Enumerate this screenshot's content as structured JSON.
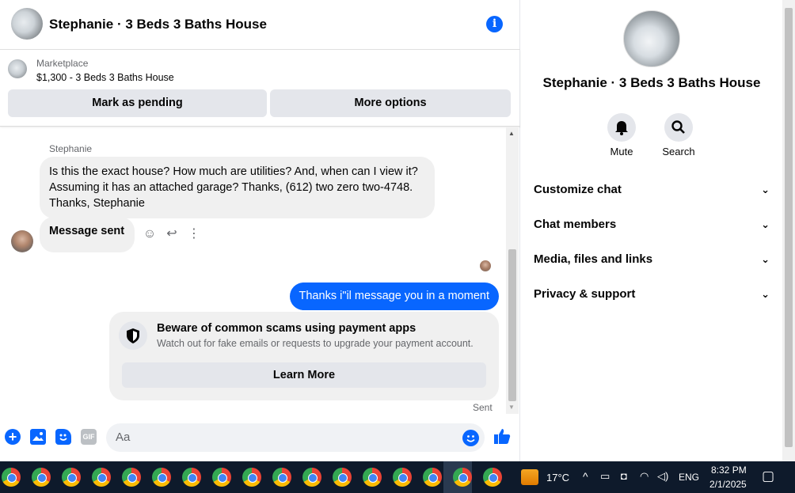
{
  "header": {
    "title": "Stephanie · 3 Beds 3 Baths House",
    "info_icon": "info-icon"
  },
  "marketplace": {
    "label": "Marketplace",
    "price_title": "$1,300 - 3 Beds 3 Baths House",
    "mark_pending": "Mark as pending",
    "more_options": "More options"
  },
  "messages": {
    "sender_name": "Stephanie",
    "incoming_text": "Is this the exact house? How much are utilities? And, when can I view it? Assuming it has an attached garage? Thanks, (612) two zero two-4748. Thanks, Stephanie",
    "sent_notice": "Message sent",
    "outgoing_text": "Thanks i\"il message you in a moment",
    "status": "Sent"
  },
  "scam_warning": {
    "title": "Beware of common scams using payment apps",
    "subtitle": "Watch out for fake emails or requests to upgrade your payment account.",
    "button": "Learn More"
  },
  "composer": {
    "placeholder": "Aa",
    "gif_label": "GIF"
  },
  "side_panel": {
    "title": "Stephanie · 3 Beds 3 Baths House",
    "mute_label": "Mute",
    "search_label": "Search",
    "sections": [
      "Customize chat",
      "Chat members",
      "Media, files and links",
      "Privacy & support"
    ]
  },
  "taskbar": {
    "temperature": "17°C",
    "language": "ENG",
    "time": "8:32 PM",
    "date": "2/1/2025",
    "app_count": 17
  },
  "colors": {
    "accent": "#0866ff",
    "bubble_gray": "#f0f0f0",
    "button_gray": "#e4e6eb",
    "taskbar": "#0e1a2b"
  }
}
